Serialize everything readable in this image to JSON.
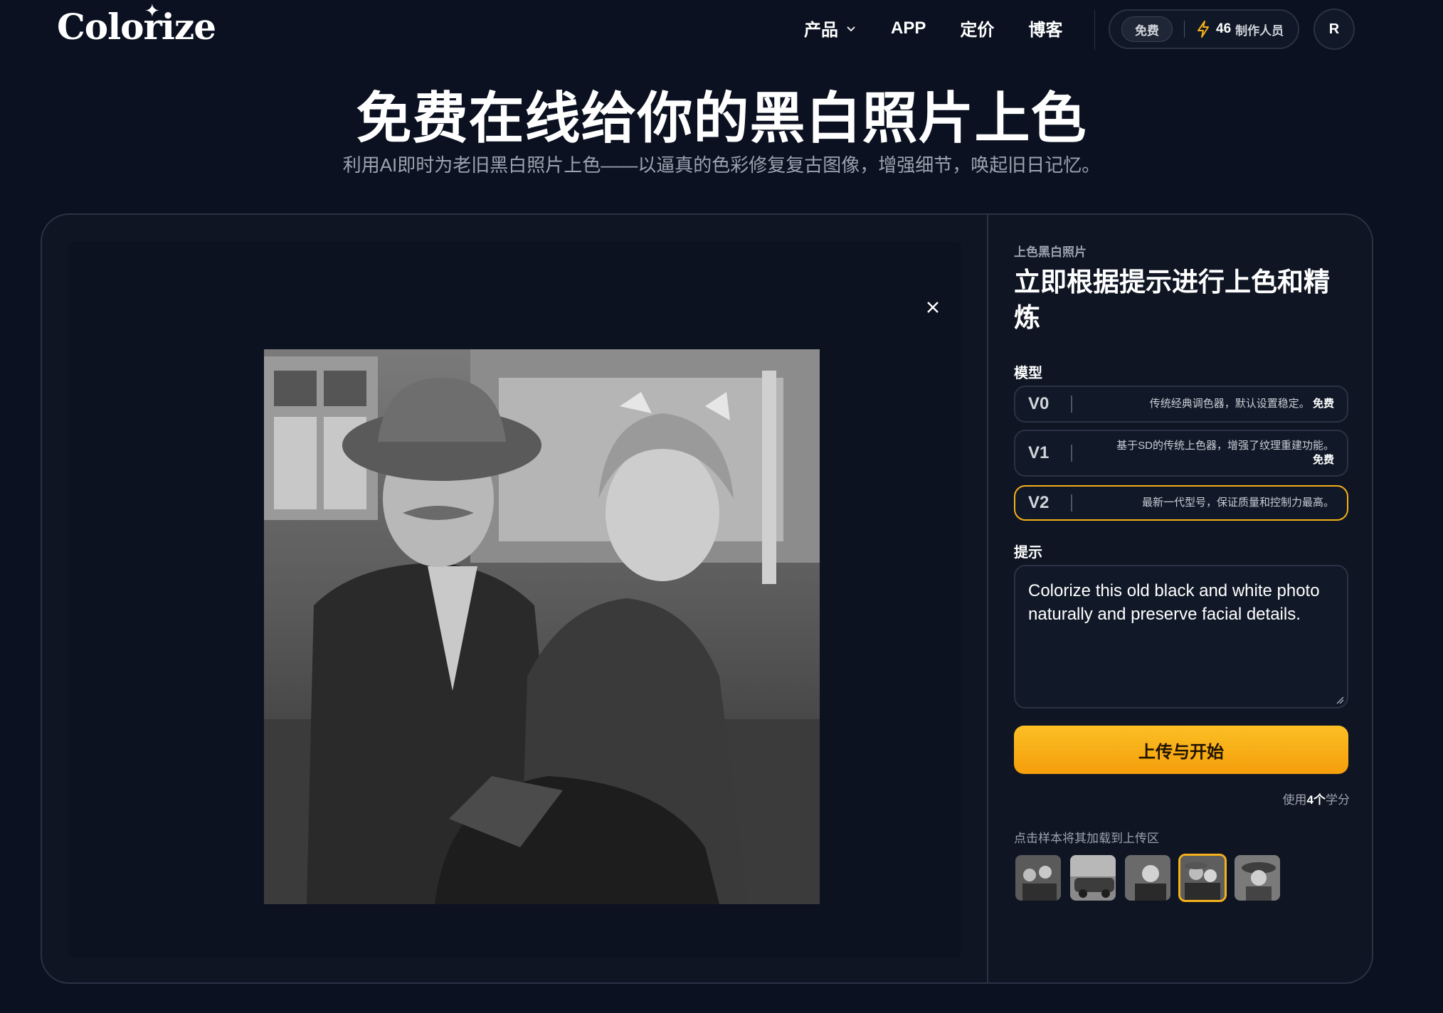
{
  "header": {
    "logo": "Colorize",
    "nav": [
      {
        "label": "产品",
        "has_dropdown": true
      },
      {
        "label": "APP"
      },
      {
        "label": "定价"
      },
      {
        "label": "博客"
      }
    ],
    "free_badge": "免费",
    "credits": "46",
    "credits_label": "制作人员",
    "avatar_initial": "R"
  },
  "hero": {
    "title": "免费在线给你的黑白照片上色",
    "subtitle": "利用AI即时为老旧黑白照片上色——以逼真的色彩修复复古图像，增强细节，唤起旧日记忆。"
  },
  "panel": {
    "eyebrow": "上色黑白照片",
    "title": "立即根据提示进行上色和精炼",
    "model_label": "模型",
    "models": [
      {
        "name": "V0",
        "desc": "传统经典调色器，默认设置稳定。",
        "tag": "免费",
        "selected": false
      },
      {
        "name": "V1",
        "desc": "基于SD的传统上色器，增强了纹理重建功能。",
        "tag": "免费",
        "selected": false
      },
      {
        "name": "V2",
        "desc": "最新一代型号，保证质量和控制力最高。",
        "tag": "",
        "selected": true
      }
    ],
    "prompt_label": "提示",
    "prompt_value": "Colorize this old black and white photo naturally and preserve facial details.",
    "start_button": "上传与开始",
    "cost_prefix": "使用",
    "cost_value": "4个",
    "cost_suffix": "学分",
    "samples_hint": "点击样本将其加载到上传区",
    "samples_selected_index": 3
  },
  "colors": {
    "background": "#0b1120",
    "accent": "#f4b11a",
    "border": "#2a3243"
  }
}
